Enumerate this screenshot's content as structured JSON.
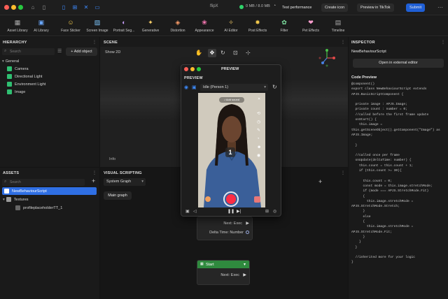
{
  "titlebar": {
    "app_title": "flipX",
    "memory": "0 MB / 8.0 MB",
    "test_performance": "Test performance",
    "create_icon": "Create icon",
    "preview_tiktok": "Preview in TikTok",
    "submit": "Submit"
  },
  "toolbar": {
    "items": [
      {
        "label": "Asset Library",
        "icon": "library-icon"
      },
      {
        "label": "AI Library",
        "icon": "ai-library-icon"
      },
      {
        "label": "Face Sticker",
        "icon": "face-sticker-icon"
      },
      {
        "label": "Screen Image",
        "icon": "screen-image-icon"
      },
      {
        "label": "Portrait Seg...",
        "icon": "portrait-icon"
      },
      {
        "label": "Generative",
        "icon": "generative-icon"
      },
      {
        "label": "Distortion",
        "icon": "distortion-icon"
      },
      {
        "label": "Appearance",
        "icon": "appearance-icon"
      },
      {
        "label": "AI Editor",
        "icon": "ai-editor-icon"
      },
      {
        "label": "Post Effects",
        "icon": "post-effects-icon"
      },
      {
        "label": "Filter",
        "icon": "filter-icon"
      },
      {
        "label": "Pet Effects",
        "icon": "pet-effects-icon"
      },
      {
        "label": "Timeline",
        "icon": "timeline-icon"
      }
    ]
  },
  "hierarchy": {
    "title": "HIERARCHY",
    "search_placeholder": "Search",
    "add_object": "+ Add object",
    "group": "General",
    "items": [
      "Camera",
      "Directional Light",
      "Environment Light",
      "Image"
    ]
  },
  "scene": {
    "title": "SCENE",
    "show2d": "Show 2D",
    "info": "Info"
  },
  "preview": {
    "window_title": "PREVIEW",
    "panel_label": "PREVIEW",
    "dropdown_value": "Idle (Person 1)",
    "sound_label": "Add sound",
    "countdown": "1"
  },
  "assets": {
    "title": "ASSETS",
    "search_placeholder": "Search",
    "items": [
      "NewBehaviourScript",
      "Textures",
      "profileplaceholderTT_1"
    ]
  },
  "visual_scripting": {
    "title": "VISUAL SCRIPTING",
    "graph_select": "System Graph",
    "main_graph": "Main graph",
    "node1_next": "Next: Exec",
    "node1_delta": "Delta Time: Number",
    "node2_title": "Start",
    "node2_next": "Next: Exec"
  },
  "inspector": {
    "title": "INSPECTOR",
    "script_name": "NewBehaviourScript",
    "open_external": "Open in external editor",
    "code_preview_label": "Code Preview",
    "code_lines": [
      "@component()",
      "export class NewBehaviourScript extends",
      "APJS.BasicScriptComponent {",
      "",
      "  private image : APJS.Image;",
      "  private count : number = 0;",
      "  //called before the first frame update",
      "  onStart() {",
      "    this.image =",
      "this.getSceneObject().getComponent(\"Image\") as",
      "APJS.Image;",
      "",
      "  }",
      "",
      "  //called once per frame",
      "  onUpdate(deltaTime: number) {",
      "    this.count = this.count + 1;",
      "    if (this.count >= 30){",
      "",
      "      this.count = 0;",
      "      const mode = this.image.stretchMode;",
      "      if (mode === APJS.StretchMode.Fit)",
      "      {",
      "        this.image.stretchMode =",
      "APJS.StretchMode.Stretch;",
      "      }",
      "      else",
      "      {",
      "        this.image.stretchMode =",
      "APJS.StretchMode.Fit;",
      "      }",
      "    }",
      "  }",
      "",
      "  //inherited more for your logic",
      "}"
    ]
  },
  "colors": {
    "accent": "#2f6fe4",
    "submit": "#1f5fd6",
    "record": "#ff2d45",
    "node_green": "#2f8a3e"
  }
}
